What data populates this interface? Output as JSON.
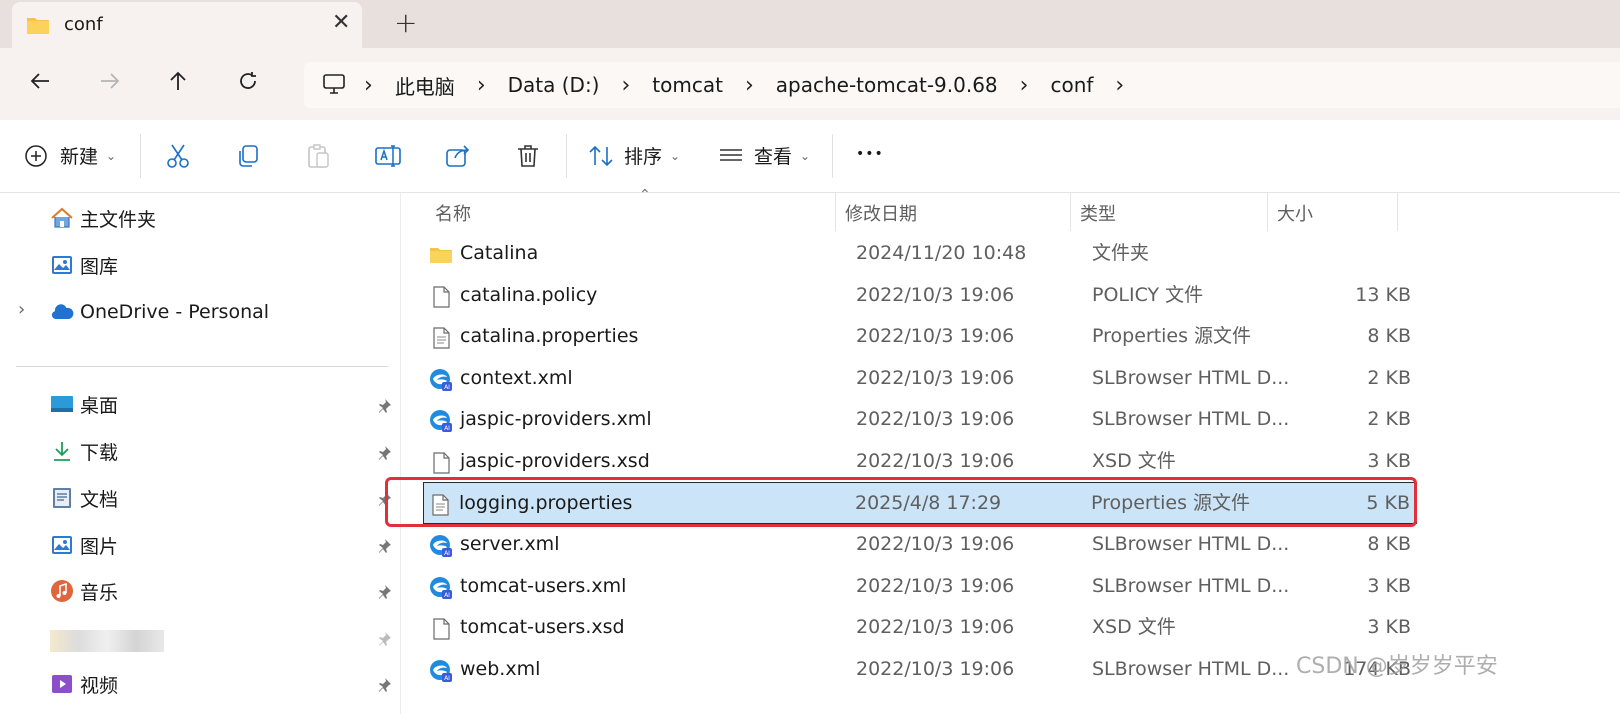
{
  "window": {
    "tab_title": "conf",
    "new_tab_symbol": "+",
    "close_symbol": "✕"
  },
  "nav": {
    "breadcrumbs": [
      "此电脑",
      "Data (D:)",
      "tomcat",
      "apache-tomcat-9.0.68",
      "conf"
    ],
    "separator": "›"
  },
  "toolbar": {
    "new_label": "新建",
    "sort_label": "排序",
    "view_label": "查看",
    "more_label": "•••"
  },
  "sidebar": {
    "quick": [
      {
        "label": "主文件夹",
        "icon": "home-icon"
      },
      {
        "label": "图库",
        "icon": "gallery-icon"
      },
      {
        "label": "OneDrive - Personal",
        "icon": "cloud-icon"
      }
    ],
    "pinned": [
      {
        "label": "桌面",
        "icon": "desktop-icon"
      },
      {
        "label": "下载",
        "icon": "download-icon"
      },
      {
        "label": "文档",
        "icon": "documents-icon"
      },
      {
        "label": "图片",
        "icon": "pictures-icon"
      },
      {
        "label": "音乐",
        "icon": "music-icon"
      },
      {
        "label": "视频",
        "icon": "videos-icon"
      }
    ]
  },
  "columns": {
    "name": "名称",
    "date": "修改日期",
    "type": "类型",
    "size": "大小"
  },
  "files": [
    {
      "name": "Catalina",
      "date": "2024/11/20 10:48",
      "type": "文件夹",
      "size": "",
      "icon": "folder-icon"
    },
    {
      "name": "catalina.policy",
      "date": "2022/10/3 19:06",
      "type": "POLICY 文件",
      "size": "13 KB",
      "icon": "file-icon"
    },
    {
      "name": "catalina.properties",
      "date": "2022/10/3 19:06",
      "type": "Properties 源文件",
      "size": "8 KB",
      "icon": "text-file-icon"
    },
    {
      "name": "context.xml",
      "date": "2022/10/3 19:06",
      "type": "SLBrowser HTML D...",
      "size": "2 KB",
      "icon": "browser-doc-icon"
    },
    {
      "name": "jaspic-providers.xml",
      "date": "2022/10/3 19:06",
      "type": "SLBrowser HTML D...",
      "size": "2 KB",
      "icon": "browser-doc-icon"
    },
    {
      "name": "jaspic-providers.xsd",
      "date": "2022/10/3 19:06",
      "type": "XSD 文件",
      "size": "3 KB",
      "icon": "file-icon"
    },
    {
      "name": "logging.properties",
      "date": "2025/4/8 17:29",
      "type": "Properties 源文件",
      "size": "5 KB",
      "icon": "text-file-icon",
      "selected": true
    },
    {
      "name": "server.xml",
      "date": "2022/10/3 19:06",
      "type": "SLBrowser HTML D...",
      "size": "8 KB",
      "icon": "browser-doc-icon"
    },
    {
      "name": "tomcat-users.xml",
      "date": "2022/10/3 19:06",
      "type": "SLBrowser HTML D...",
      "size": "3 KB",
      "icon": "browser-doc-icon"
    },
    {
      "name": "tomcat-users.xsd",
      "date": "2022/10/3 19:06",
      "type": "XSD 文件",
      "size": "3 KB",
      "icon": "file-icon"
    },
    {
      "name": "web.xml",
      "date": "2022/10/3 19:06",
      "type": "SLBrowser HTML D...",
      "size": "174 KB",
      "icon": "browser-doc-icon"
    }
  ],
  "watermark": "CSDN @岁岁岁平安"
}
